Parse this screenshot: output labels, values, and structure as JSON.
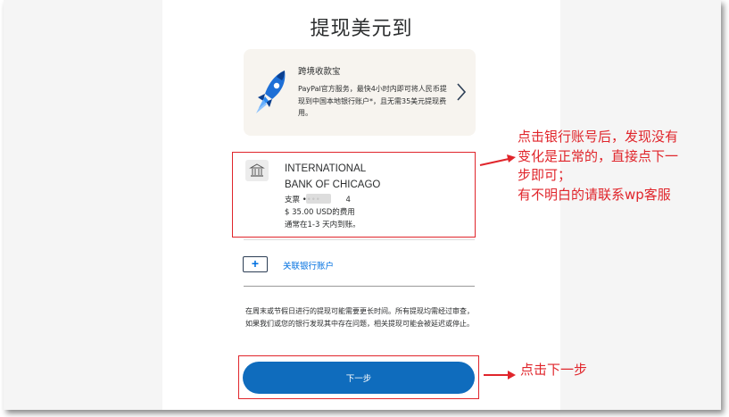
{
  "page": {
    "title": "提现美元到"
  },
  "promo": {
    "title": "跨境收款宝",
    "body": "PayPal官方服务，最快4小时内即可将人民币提现到中国本地银行账户*，且无需35美元提现费用。",
    "icon": "rocket-icon",
    "chevron_icon": "chevron-right-icon"
  },
  "bank": {
    "icon": "bank-icon",
    "name_line1": "INTERNATIONAL",
    "name_line2": "BANK OF CHICAGO",
    "account_prefix": "支票 •••• ",
    "account_suffix": "4",
    "fee": "$ 35.00 USD的费用",
    "eta": "通常在1-3 天内到账。"
  },
  "link_bank": {
    "label": "关联银行账户",
    "icon": "plus-icon",
    "icon_glyph": "+"
  },
  "notice": "在周末或节假日进行的提现可能需要更长时间。所有提现均需经过审查，如果我们或您的银行发现其中存在问题，相关提现可能会被延迟或停止。",
  "next_button": {
    "label": "下一步"
  },
  "annotations": {
    "bank_note": [
      "点击银行账号后，发现没有",
      "变化是正常的，直接点下一",
      "步即可；",
      "有不明白的请联系wp客服"
    ],
    "next_note": "点击下一步",
    "color": "#e0252b"
  },
  "colors": {
    "primary_button": "#0f6cbd",
    "link": "#0070e0",
    "promo_bg": "#f7f4ef",
    "annotation": "#e0252b"
  }
}
